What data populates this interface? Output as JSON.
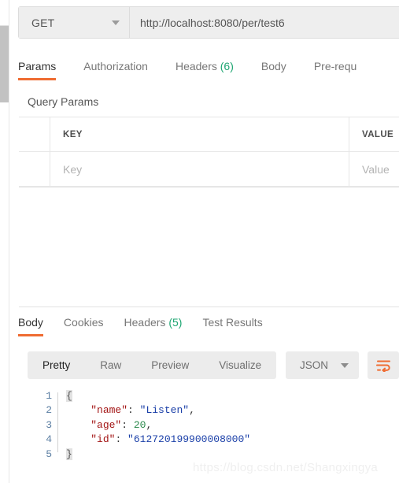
{
  "request": {
    "method": "GET",
    "url": "http://localhost:8080/per/test6",
    "tabs": [
      {
        "label": "Params",
        "count": "",
        "active": true
      },
      {
        "label": "Authorization",
        "count": "",
        "active": false
      },
      {
        "label": "Headers",
        "count": "(6)",
        "active": false
      },
      {
        "label": "Body",
        "count": "",
        "active": false
      },
      {
        "label": "Pre-requ",
        "count": "",
        "active": false
      }
    ],
    "query_params": {
      "section_title": "Query Params",
      "columns": [
        "KEY",
        "VALUE"
      ],
      "rows": [
        {
          "key_placeholder": "Key",
          "value_placeholder": "Value"
        }
      ]
    }
  },
  "response": {
    "tabs": [
      {
        "label": "Body",
        "count": "",
        "active": true
      },
      {
        "label": "Cookies",
        "count": "",
        "active": false
      },
      {
        "label": "Headers",
        "count": "(5)",
        "active": false
      },
      {
        "label": "Test Results",
        "count": "",
        "active": false
      }
    ],
    "view_modes": [
      "Pretty",
      "Raw",
      "Preview",
      "Visualize"
    ],
    "active_view_mode": "Pretty",
    "format": "JSON",
    "body_lines": [
      {
        "num": "1",
        "parts": [
          {
            "t": "{",
            "c": "brace"
          }
        ]
      },
      {
        "num": "2",
        "parts": [
          {
            "t": "    ",
            "c": "punc"
          },
          {
            "t": "\"name\"",
            "c": "key"
          },
          {
            "t": ": ",
            "c": "punc"
          },
          {
            "t": "\"Listen\"",
            "c": "str"
          },
          {
            "t": ",",
            "c": "punc"
          }
        ]
      },
      {
        "num": "3",
        "parts": [
          {
            "t": "    ",
            "c": "punc"
          },
          {
            "t": "\"age\"",
            "c": "key"
          },
          {
            "t": ": ",
            "c": "punc"
          },
          {
            "t": "20",
            "c": "num"
          },
          {
            "t": ",",
            "c": "punc"
          }
        ]
      },
      {
        "num": "4",
        "parts": [
          {
            "t": "    ",
            "c": "punc"
          },
          {
            "t": "\"id\"",
            "c": "key"
          },
          {
            "t": ": ",
            "c": "punc"
          },
          {
            "t": "\"612720199900008000\"",
            "c": "str"
          }
        ]
      },
      {
        "num": "5",
        "parts": [
          {
            "t": "}",
            "c": "brace"
          }
        ]
      }
    ]
  },
  "icons": {
    "method_caret": "chevron-down-icon",
    "format_caret": "chevron-down-icon",
    "wrap": "word-wrap-icon"
  },
  "colors": {
    "accent": "#ef6c32",
    "count_green": "#1ea672",
    "toolbar_bg": "#ececec"
  },
  "watermark": "https://blog.csdn.net/Shangxingya"
}
